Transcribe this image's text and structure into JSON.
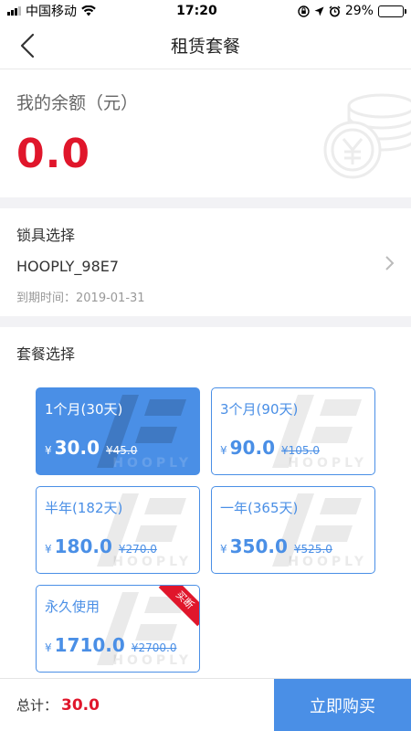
{
  "status_bar": {
    "carrier": "中国移动",
    "time": "17:20",
    "battery": "29%",
    "battery_level": 0.29
  },
  "nav": {
    "title": "租赁套餐"
  },
  "balance": {
    "label": "我的余额（元）",
    "amount": "0.0"
  },
  "lock": {
    "title": "锁具选择",
    "name": "HOOPLY_98E7",
    "expire_label": "到期时间：",
    "expire_date": "2019-01-31"
  },
  "plans": {
    "title": "套餐选择",
    "currency": "¥",
    "watermark": "HOOPLY",
    "items": [
      {
        "name": "1个月(30天)",
        "price": "30.0",
        "original": "45.0",
        "selected": true
      },
      {
        "name": "3个月(90天)",
        "price": "90.0",
        "original": "105.0",
        "selected": false
      },
      {
        "name": "半年(182天)",
        "price": "180.0",
        "original": "270.0",
        "selected": false
      },
      {
        "name": "一年(365天)",
        "price": "350.0",
        "original": "525.0",
        "selected": false
      },
      {
        "name": "永久使用",
        "price": "1710.0",
        "original": "2700.0",
        "selected": false,
        "badge": "买断"
      }
    ]
  },
  "footer": {
    "total_label": "总计：",
    "total_value": "30.0",
    "buy_label": "立即购买"
  },
  "colors": {
    "accent": "#4a8fe6",
    "price_red": "#e0162b"
  }
}
